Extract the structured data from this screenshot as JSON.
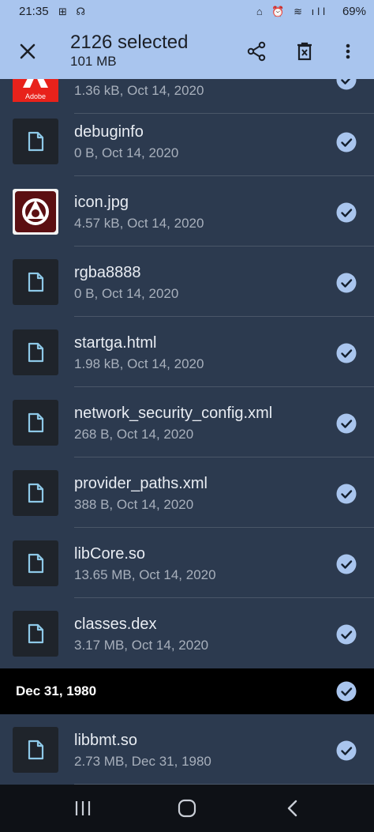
{
  "status": {
    "time": "21:35",
    "left_icons": "⊞ ☊",
    "right_icons": "⌂ ⏰ ≋ ıll",
    "battery": "69%"
  },
  "appbar": {
    "title": "2126 selected",
    "subtitle": "101 MB"
  },
  "files": [
    {
      "name": "",
      "meta": "1.36 kB, Oct 14, 2020",
      "thumb": "adobe",
      "logo_text": "Adobe"
    },
    {
      "name": "debuginfo",
      "meta": "0 B, Oct 14, 2020",
      "thumb": "doc"
    },
    {
      "name": "icon.jpg",
      "meta": "4.57 kB, Oct 14, 2020",
      "thumb": "air"
    },
    {
      "name": "rgba8888",
      "meta": "0 B, Oct 14, 2020",
      "thumb": "doc"
    },
    {
      "name": "startga.html",
      "meta": "1.98 kB, Oct 14, 2020",
      "thumb": "doc"
    },
    {
      "name": "network_security_config.xml",
      "meta": "268 B, Oct 14, 2020",
      "thumb": "doc"
    },
    {
      "name": "provider_paths.xml",
      "meta": "388 B, Oct 14, 2020",
      "thumb": "doc"
    },
    {
      "name": "libCore.so",
      "meta": "13.65 MB, Oct 14, 2020",
      "thumb": "doc"
    },
    {
      "name": "classes.dex",
      "meta": "3.17 MB, Oct 14, 2020",
      "thumb": "doc"
    }
  ],
  "section": {
    "label": "Dec 31, 1980"
  },
  "files2": [
    {
      "name": "libbmt.so",
      "meta": "2.73 MB, Dec 31, 1980",
      "thumb": "doc"
    }
  ],
  "colors": {
    "accent": "#a9c5ee",
    "background": "#2c3a4f",
    "check": "#a9c5ee",
    "doc_icon": "#8ec9e8"
  }
}
